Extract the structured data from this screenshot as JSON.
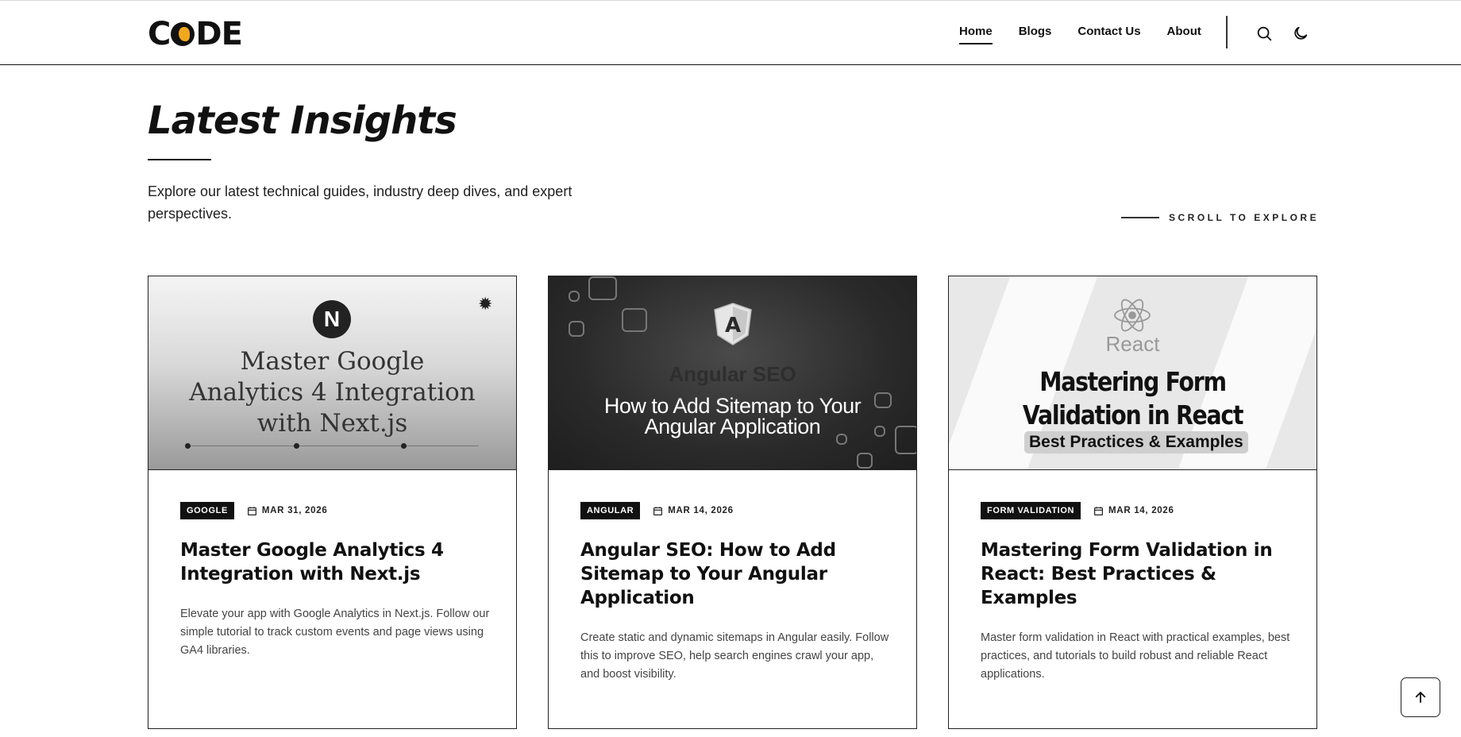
{
  "header": {
    "logo_text": "CODE",
    "nav": [
      {
        "label": "Home",
        "active": true
      },
      {
        "label": "Blogs",
        "active": false
      },
      {
        "label": "Contact Us",
        "active": false
      },
      {
        "label": "About",
        "active": false
      }
    ],
    "icons": [
      "search-icon",
      "moon-icon"
    ]
  },
  "hero": {
    "title": "Latest Insights",
    "intro": "Explore our latest technical guides, industry deep dives, and expert perspectives.",
    "scroll_label": "SCROLL TO EXPLORE"
  },
  "cards": [
    {
      "thumb_logo": "N",
      "thumb_title": "Master Google Analytics 4 Integration with Next.js",
      "tag": "GOOGLE",
      "date": "MAR 31, 2026",
      "title": "Master Google Analytics 4 Integration with Next.js",
      "description": "Elevate your app with Google Analytics in Next.js. Follow our simple tutorial to track custom events and page views using GA4 libraries."
    },
    {
      "thumb_logo": "A",
      "thumb_ghost": "Angular SEO",
      "thumb_title": "How to Add Sitemap to Your Angular Application",
      "tag": "ANGULAR",
      "date": "MAR 14, 2026",
      "title": "Angular SEO: How to Add Sitemap to Your Angular Application",
      "description": "Create static and dynamic sitemaps in Angular easily. Follow this to improve SEO, help search engines crawl your app, and boost visibility."
    },
    {
      "thumb_logo_text": "React",
      "thumb_title": "Mastering Form Validation in React",
      "thumb_subtitle": "Best Practices & Examples",
      "tag": "FORM VALIDATION",
      "date": "MAR 14, 2026",
      "title": "Mastering Form Validation in React: Best Practices & Examples",
      "description": "Master form validation in React with practical examples, best practices, and tutorials to build robust and reliable React applications."
    }
  ],
  "back_to_top_icon": "arrow-up-icon"
}
